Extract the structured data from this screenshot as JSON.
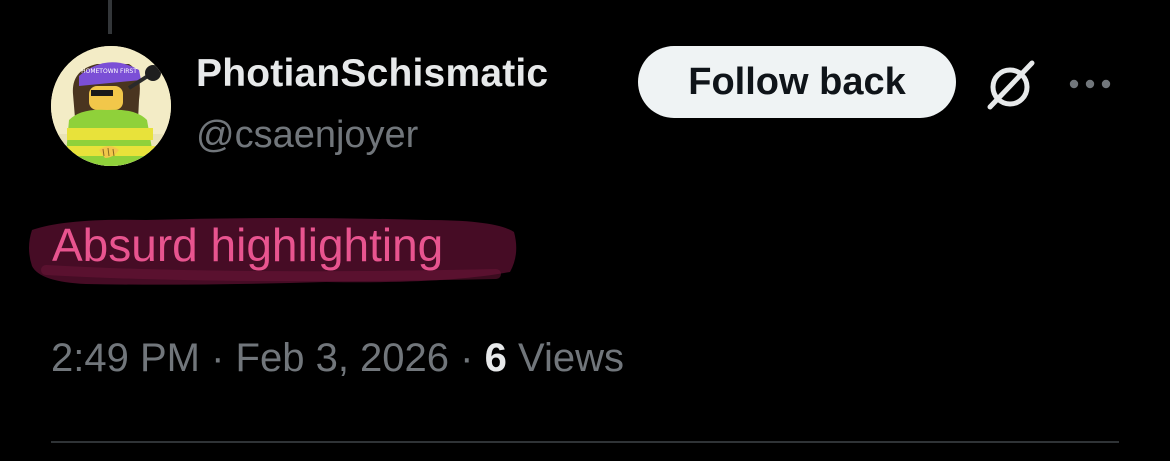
{
  "tweet": {
    "author": {
      "display_name": "PhotianSchismatic",
      "handle": "@csaenjoyer",
      "avatar_cap_text": "HOMETOWN FIRST"
    },
    "actions": {
      "follow_label": "Follow back",
      "grok_icon": "slashed-circle-icon",
      "more_icon": "more-dots-icon"
    },
    "text": "Absurd highlighting",
    "meta": {
      "time": "2:49 PM",
      "separator": "·",
      "date": "Feb 3, 2026",
      "views_count": "6",
      "views_label": "Views"
    }
  },
  "colors": {
    "background": "#000000",
    "highlight_text": "#e8548f",
    "highlight_marker": "#5a1030",
    "follow_button_bg": "#eff3f4"
  }
}
